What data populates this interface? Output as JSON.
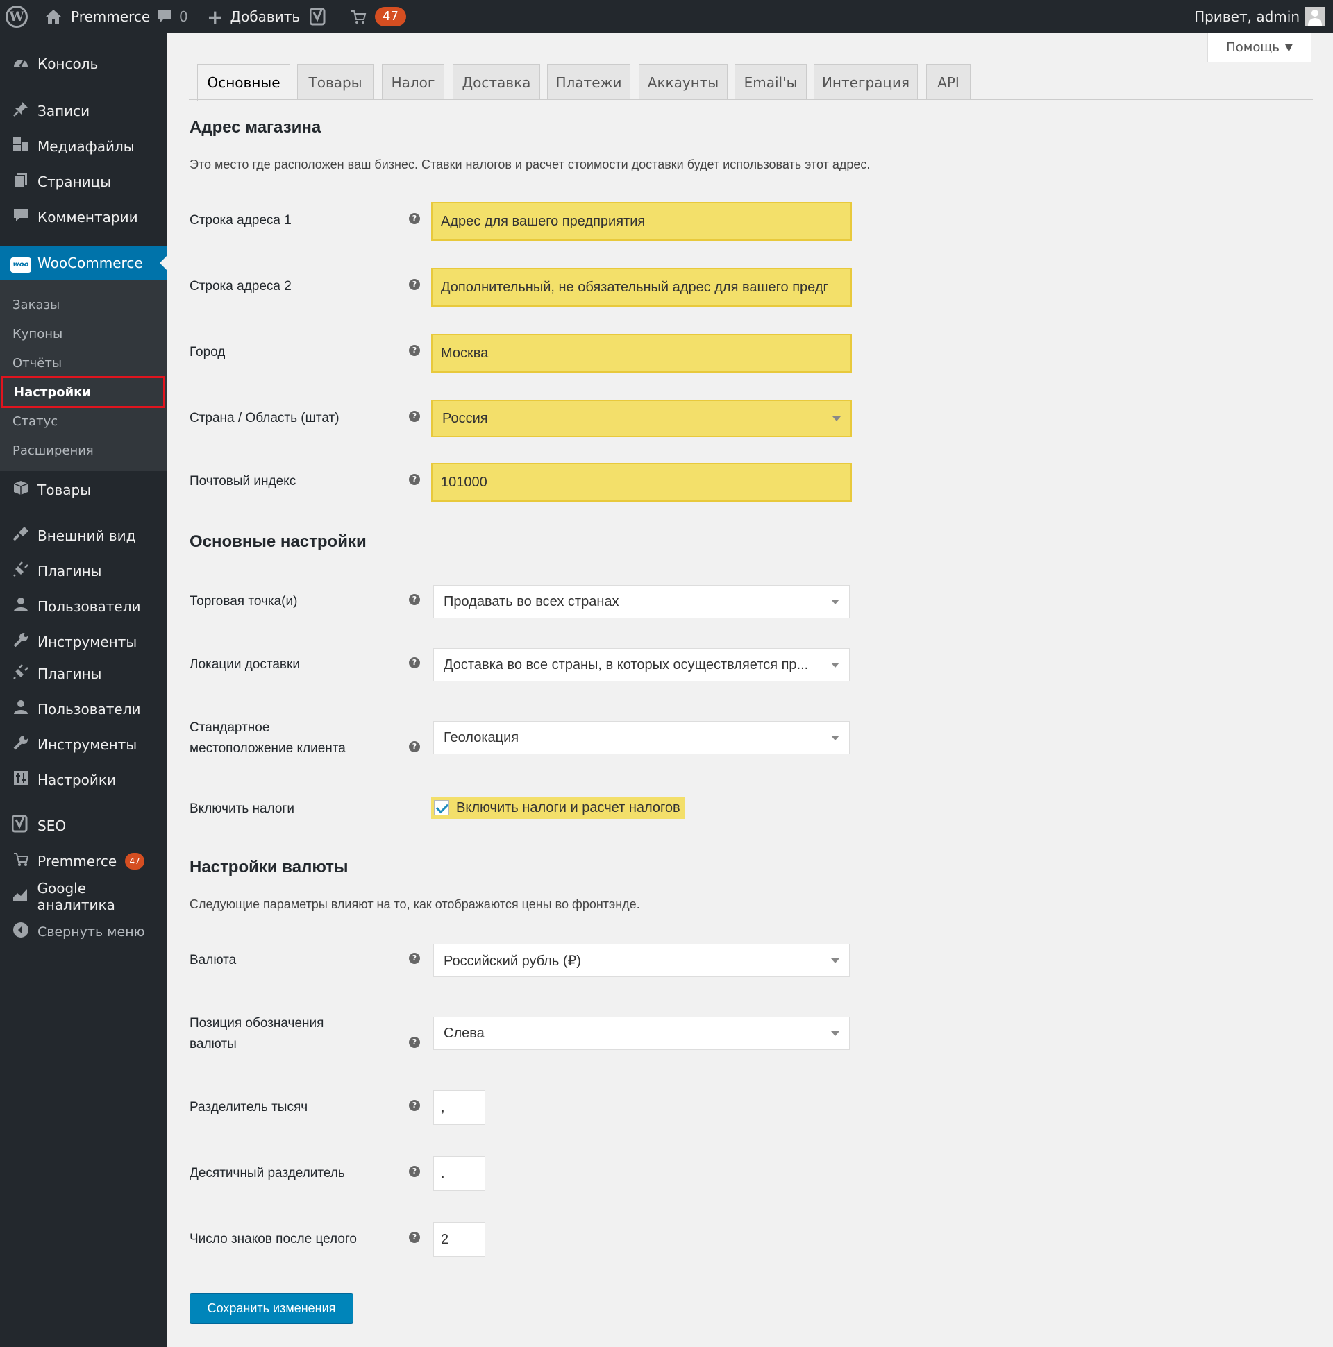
{
  "adminbar": {
    "wp_logo": "W",
    "site_name": "Premmerce",
    "comments_count": "0",
    "new_label": "Добавить",
    "cart_count": "47",
    "greeting": "Привет, admin"
  },
  "sidebar": {
    "items": [
      {
        "label": "Консоль",
        "icon": "dashboard-icon"
      },
      {
        "label": "Записи",
        "icon": "pin-icon"
      },
      {
        "label": "Медиафайлы",
        "icon": "media-icon"
      },
      {
        "label": "Страницы",
        "icon": "pages-icon"
      },
      {
        "label": "Комментарии",
        "icon": "comments-icon"
      },
      {
        "label": "WooCommerce",
        "icon": "woo-icon"
      },
      {
        "label": "Товары",
        "icon": "box-icon"
      },
      {
        "label": "Внешний вид",
        "icon": "brush-icon"
      },
      {
        "label": "Плагины",
        "icon": "plugin-icon"
      },
      {
        "label": "Пользователи",
        "icon": "user-icon"
      },
      {
        "label": "Инструменты",
        "icon": "wrench-icon"
      },
      {
        "label": "Плагины",
        "icon": "plugin-icon"
      },
      {
        "label": "Пользователи",
        "icon": "user-icon"
      },
      {
        "label": "Инструменты",
        "icon": "wrench-icon"
      },
      {
        "label": "Настройки",
        "icon": "settings-icon"
      },
      {
        "label": "SEO",
        "icon": "yoast-icon"
      },
      {
        "label": "Premmerce",
        "icon": "cart-icon",
        "badge": "47"
      },
      {
        "label": "Google аналитика",
        "icon": "analytics-icon"
      },
      {
        "label": "Свернуть меню",
        "icon": "collapse-icon"
      }
    ],
    "woo_logo": "woo",
    "submenu": [
      {
        "label": "Заказы"
      },
      {
        "label": "Купоны"
      },
      {
        "label": "Отчёты"
      },
      {
        "label": "Настройки"
      },
      {
        "label": "Статус"
      },
      {
        "label": "Расширения"
      }
    ]
  },
  "help_label": "Помощь",
  "tabs": [
    "Основные",
    "Товары",
    "Налог",
    "Доставка",
    "Платежи",
    "Аккаунты",
    "Email'ы",
    "Интеграция",
    "API"
  ],
  "store_address": {
    "title": "Адрес магазина",
    "description": "Это место где расположен ваш бизнес. Ставки налогов и расчет стоимости доставки будет использовать этот адрес.",
    "address1_label": "Строка адреса 1",
    "address1_value": "Адрес для вашего предприятия",
    "address2_label": "Строка адреса 2",
    "address2_value": "Дополнительный, не обязательный адрес для вашего предг",
    "city_label": "Город",
    "city_value": "Москва",
    "country_label": "Страна / Область (штат)",
    "country_value": "Россия",
    "postcode_label": "Почтовый индекс",
    "postcode_value": "101000"
  },
  "general": {
    "title": "Основные настройки",
    "selling_label": "Торговая точка(и)",
    "selling_value": "Продавать во всех странах",
    "shipping_label": "Локации доставки",
    "shipping_value": "Доставка во все страны, в которых осуществляется пр...",
    "default_location_label_1": "Стандартное",
    "default_location_label_2": "местоположение клиента",
    "default_location_value": "Геолокация",
    "taxes_label": "Включить налоги",
    "taxes_checkbox_label": "Включить налоги и расчет налогов"
  },
  "currency": {
    "title": "Настройки валюты",
    "description": "Следующие параметры влияют на то, как отображаются цены во фронтэнде.",
    "currency_label": "Валюта",
    "currency_value": "Российский рубль (₽)",
    "position_label_1": "Позиция обозначения",
    "position_label_2": "валюты",
    "position_value": "Слева",
    "thousand_label": "Разделитель тысяч",
    "thousand_value": ",",
    "decimal_label": "Десятичный разделитель",
    "decimal_value": ".",
    "decimals_label": "Число знаков после целого",
    "decimals_value": "2"
  },
  "help_tip": "?",
  "save_label": "Сохранить изменения"
}
